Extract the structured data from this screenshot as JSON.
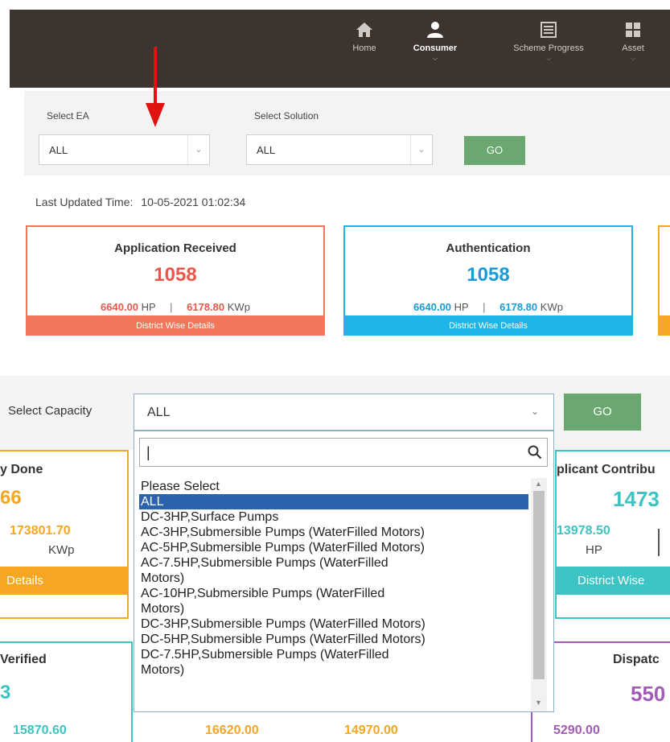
{
  "nav": {
    "items": [
      {
        "label": "Home",
        "icon": "home-icon"
      },
      {
        "label": "Consumer",
        "icon": "user-icon",
        "active": true
      },
      {
        "label": "Scheme Progress",
        "icon": "list-icon"
      },
      {
        "label": "Asset",
        "icon": "grid-icon"
      }
    ]
  },
  "filters": {
    "ea_label": "Select EA",
    "ea_value": "ALL",
    "solution_label": "Select Solution",
    "solution_value": "ALL",
    "go_label": "GO"
  },
  "last_updated": {
    "label": "Last Updated Time:",
    "value": "10-05-2021 01:02:34"
  },
  "cards": [
    {
      "title": "Application Received",
      "count": "1058",
      "hp": "6640.00",
      "hp_unit": "HP",
      "sep": "|",
      "kwp": "6178.80",
      "kwp_unit": "KWp",
      "footer": "District Wise Details",
      "color": "#f0775a"
    },
    {
      "title": "Authentication",
      "count": "1058",
      "hp": "6640.00",
      "hp_unit": "HP",
      "sep": "|",
      "kwp": "6178.80",
      "kwp_unit": "KWp",
      "footer": "District Wise Details",
      "color": "#1fb3e8"
    }
  ],
  "capacity": {
    "label": "Select Capacity",
    "value": "ALL",
    "go_label": "GO",
    "search_value": "|",
    "options": [
      "Please Select",
      "ALL",
      "DC-3HP,Surface Pumps",
      "AC-3HP,Submersible Pumps (WaterFilled Motors)",
      "AC-5HP,Submersible Pumps (WaterFilled Motors)",
      "AC-7.5HP,Submersible Pumps (WaterFilled",
      "Motors)",
      "AC-10HP,Submersible Pumps (WaterFilled",
      "Motors)",
      "DC-3HP,Submersible Pumps (WaterFilled Motors)",
      "DC-5HP,Submersible Pumps (WaterFilled Motors)",
      "DC-7.5HP,Submersible Pumps (WaterFilled",
      "Motors)"
    ],
    "selected_index": 1
  },
  "bg_cards": {
    "left1_title": "y Done",
    "left1_count": "66",
    "left1_value": "173801.70",
    "left1_unit": "KWp",
    "left1_footer": "Details",
    "left2_title": "Verified",
    "left2_count": "3",
    "left2_value": "15870.60",
    "right1_title": "plicant Contribu",
    "right1_count": "1473",
    "right1_value": "13978.50",
    "right1_unit": "HP",
    "right1_footer": "District Wise",
    "right2_title": "Dispatc",
    "right2_count": "550",
    "right2_value": "5290.00",
    "mid_values": [
      "16620.00",
      "14970.00"
    ]
  },
  "colors": {
    "nav_bg": "#3d3430",
    "go_green": "#6aa86f",
    "orange": "#f5a623",
    "teal": "#3cc3c3",
    "purple": "#a35bb8",
    "selected_blue": "#2d63ad",
    "arrow_red": "#e0120f"
  }
}
